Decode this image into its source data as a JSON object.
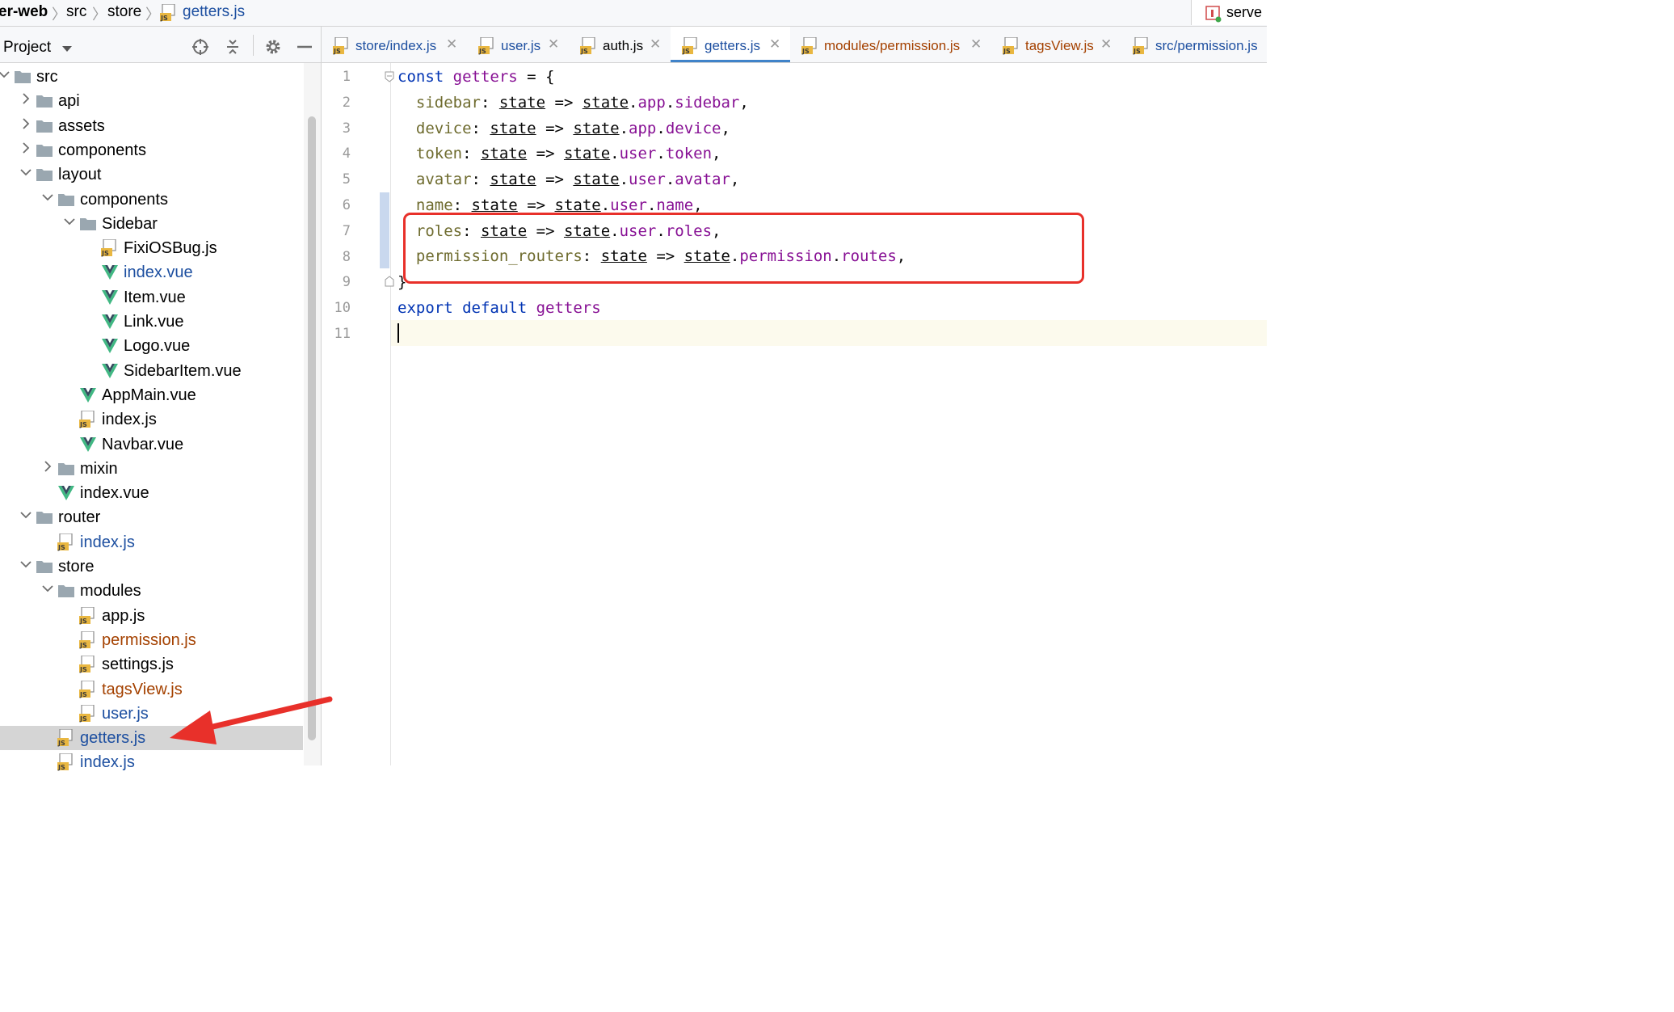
{
  "breadcrumb": {
    "items": [
      "er-web",
      "src",
      "store",
      "getters.js"
    ],
    "run_config_label": "serve"
  },
  "project_panel": {
    "title": "Project",
    "tree": [
      {
        "label": "src",
        "type": "folder",
        "depth": 0,
        "expanded": true
      },
      {
        "label": "api",
        "type": "folder",
        "depth": 1,
        "expanded": false
      },
      {
        "label": "assets",
        "type": "folder",
        "depth": 1,
        "expanded": false
      },
      {
        "label": "components",
        "type": "folder",
        "depth": 1,
        "expanded": false
      },
      {
        "label": "layout",
        "type": "folder",
        "depth": 1,
        "expanded": true
      },
      {
        "label": "components",
        "type": "folder",
        "depth": 2,
        "expanded": true
      },
      {
        "label": "Sidebar",
        "type": "folder",
        "depth": 3,
        "expanded": true
      },
      {
        "label": "FixiOSBug.js",
        "type": "js",
        "depth": 4
      },
      {
        "label": "index.vue",
        "type": "vue",
        "depth": 4,
        "status": "modified"
      },
      {
        "label": "Item.vue",
        "type": "vue",
        "depth": 4
      },
      {
        "label": "Link.vue",
        "type": "vue",
        "depth": 4
      },
      {
        "label": "Logo.vue",
        "type": "vue",
        "depth": 4
      },
      {
        "label": "SidebarItem.vue",
        "type": "vue",
        "depth": 4
      },
      {
        "label": "AppMain.vue",
        "type": "vue",
        "depth": 3
      },
      {
        "label": "index.js",
        "type": "js",
        "depth": 3
      },
      {
        "label": "Navbar.vue",
        "type": "vue",
        "depth": 3
      },
      {
        "label": "mixin",
        "type": "folder",
        "depth": 2,
        "expanded": false
      },
      {
        "label": "index.vue",
        "type": "vue",
        "depth": 2
      },
      {
        "label": "router",
        "type": "folder",
        "depth": 1,
        "expanded": true
      },
      {
        "label": "index.js",
        "type": "js",
        "depth": 2,
        "status": "modified"
      },
      {
        "label": "store",
        "type": "folder",
        "depth": 1,
        "expanded": true
      },
      {
        "label": "modules",
        "type": "folder",
        "depth": 2,
        "expanded": true
      },
      {
        "label": "app.js",
        "type": "js",
        "depth": 3
      },
      {
        "label": "permission.js",
        "type": "js",
        "depth": 3,
        "status": "added"
      },
      {
        "label": "settings.js",
        "type": "js",
        "depth": 3
      },
      {
        "label": "tagsView.js",
        "type": "js",
        "depth": 3,
        "status": "added"
      },
      {
        "label": "user.js",
        "type": "js",
        "depth": 3,
        "status": "modified"
      },
      {
        "label": "getters.js",
        "type": "js",
        "depth": 2,
        "status": "modified",
        "selected": true
      },
      {
        "label": "index.js",
        "type": "js",
        "depth": 2,
        "status": "modified"
      }
    ]
  },
  "tabs": [
    {
      "label": "store/index.js",
      "status": "modified",
      "closable": true
    },
    {
      "label": "user.js",
      "status": "modified",
      "closable": true
    },
    {
      "label": "auth.js",
      "status": "normal",
      "closable": true
    },
    {
      "label": "getters.js",
      "status": "modified",
      "closable": true,
      "active": true
    },
    {
      "label": "modules/permission.js",
      "status": "added",
      "closable": true
    },
    {
      "label": "tagsView.js",
      "status": "added",
      "closable": true
    },
    {
      "label": "src/permission.js",
      "status": "modified",
      "closable": false
    }
  ],
  "editor": {
    "line_numbers": [
      "1",
      "2",
      "3",
      "4",
      "5",
      "6",
      "7",
      "8",
      "9",
      "10",
      "11"
    ],
    "current_line": 11
  },
  "colors": {
    "modified": "#1d4fa0",
    "added": "#a44100",
    "keyword": "#0033b3",
    "property": "#871094",
    "key": "#6e6b2e",
    "annotation": "#e8302a",
    "vue_green": "#41b883"
  }
}
